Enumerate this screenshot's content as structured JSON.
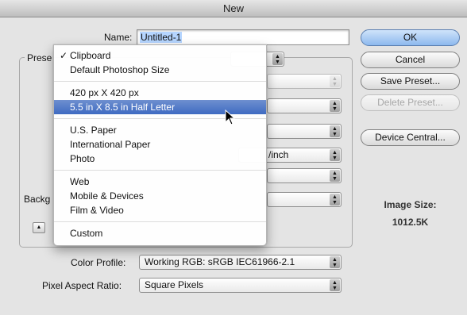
{
  "window": {
    "title": "New"
  },
  "form": {
    "name_label": "Name:",
    "name_value": "Untitled-1",
    "preset_label": "Prese",
    "background_label": "Backg",
    "color_profile_label": "Color Profile:",
    "color_profile_value": "Working RGB:  sRGB IEC61966-2.1",
    "pixel_aspect_label": "Pixel Aspect Ratio:",
    "pixel_aspect_value": "Square Pixels",
    "resolution_unit_partial": "/inch"
  },
  "preset_menu": {
    "items": [
      {
        "label": "Clipboard",
        "checked": true,
        "highlighted": false
      },
      {
        "label": "Default Photoshop Size",
        "checked": false,
        "highlighted": false
      },
      {
        "separator": true
      },
      {
        "label": "420 px X 420 px",
        "checked": false,
        "highlighted": false
      },
      {
        "label": "5.5 in X 8.5 in Half Letter",
        "checked": false,
        "highlighted": true
      },
      {
        "separator": true
      },
      {
        "label": "U.S. Paper",
        "checked": false,
        "highlighted": false
      },
      {
        "label": "International Paper",
        "checked": false,
        "highlighted": false
      },
      {
        "label": "Photo",
        "checked": false,
        "highlighted": false
      },
      {
        "separator": true
      },
      {
        "label": "Web",
        "checked": false,
        "highlighted": false
      },
      {
        "label": "Mobile & Devices",
        "checked": false,
        "highlighted": false
      },
      {
        "label": "Film & Video",
        "checked": false,
        "highlighted": false
      },
      {
        "separator": true
      },
      {
        "label": "Custom",
        "checked": false,
        "highlighted": false
      }
    ],
    "check_glyph": "✓"
  },
  "buttons": {
    "ok": "OK",
    "cancel": "Cancel",
    "save_preset": "Save Preset...",
    "delete_preset": "Delete Preset...",
    "device_central": "Device Central..."
  },
  "image_size": {
    "label": "Image Size:",
    "value": "1012.5K"
  },
  "icons": {
    "stepper": "popup-stepper-icon",
    "disclosure": "disclosure-triangle-icon",
    "cursor": "mouse-pointer-icon"
  },
  "colors": {
    "highlight": "#3f6bc2",
    "default_button": "#8db9ee",
    "selection": "#b5d5ff"
  }
}
